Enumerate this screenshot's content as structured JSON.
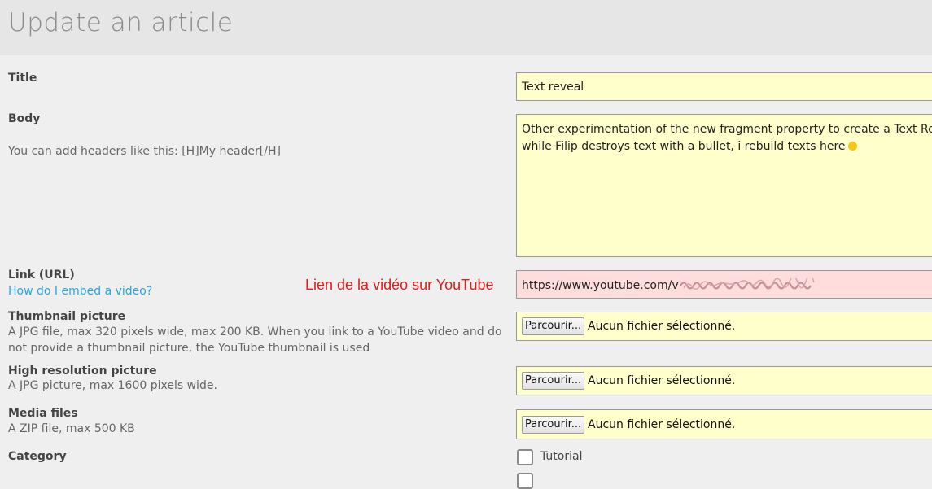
{
  "page": {
    "title": "Update an article"
  },
  "form": {
    "title": {
      "label": "Title",
      "value": "Text reveal"
    },
    "body": {
      "label": "Body",
      "help": "You can add headers like this: [H]My header[/H]",
      "line1": "Other experimentation of the new fragment property to create a Text Reveal",
      "line2": "while Filip destroys text with a bullet, i rebuild texts here"
    },
    "link": {
      "label": "Link (URL)",
      "help_link": "How do I embed a video?",
      "value": "https://www.youtube.com/v"
    },
    "thumbnail": {
      "label": "Thumbnail picture",
      "help": "A JPG file, max 320 pixels wide, max 200 KB. When you link to a YouTube video and do not provide a thumbnail picture, the YouTube thumbnail is used",
      "button": "Parcourir...",
      "status": "Aucun fichier sélectionné."
    },
    "hires": {
      "label": "High resolution picture",
      "help": "A JPG picture, max 1600 pixels wide.",
      "button": "Parcourir...",
      "status": "Aucun fichier sélectionné."
    },
    "media": {
      "label": "Media files",
      "help": "A ZIP file, max 500 KB",
      "button": "Parcourir...",
      "status": "Aucun fichier sélectionné."
    },
    "category": {
      "label": "Category",
      "options": [
        {
          "label": "Tutorial",
          "checked": false
        }
      ]
    }
  },
  "annotation": {
    "text": "Lien de la vidéo sur YouTube",
    "color": "#e31a1a"
  },
  "colors": {
    "field_bg": "#ffffcc",
    "url_field_bg": "#ffdddd",
    "link": "#27a6dd"
  }
}
